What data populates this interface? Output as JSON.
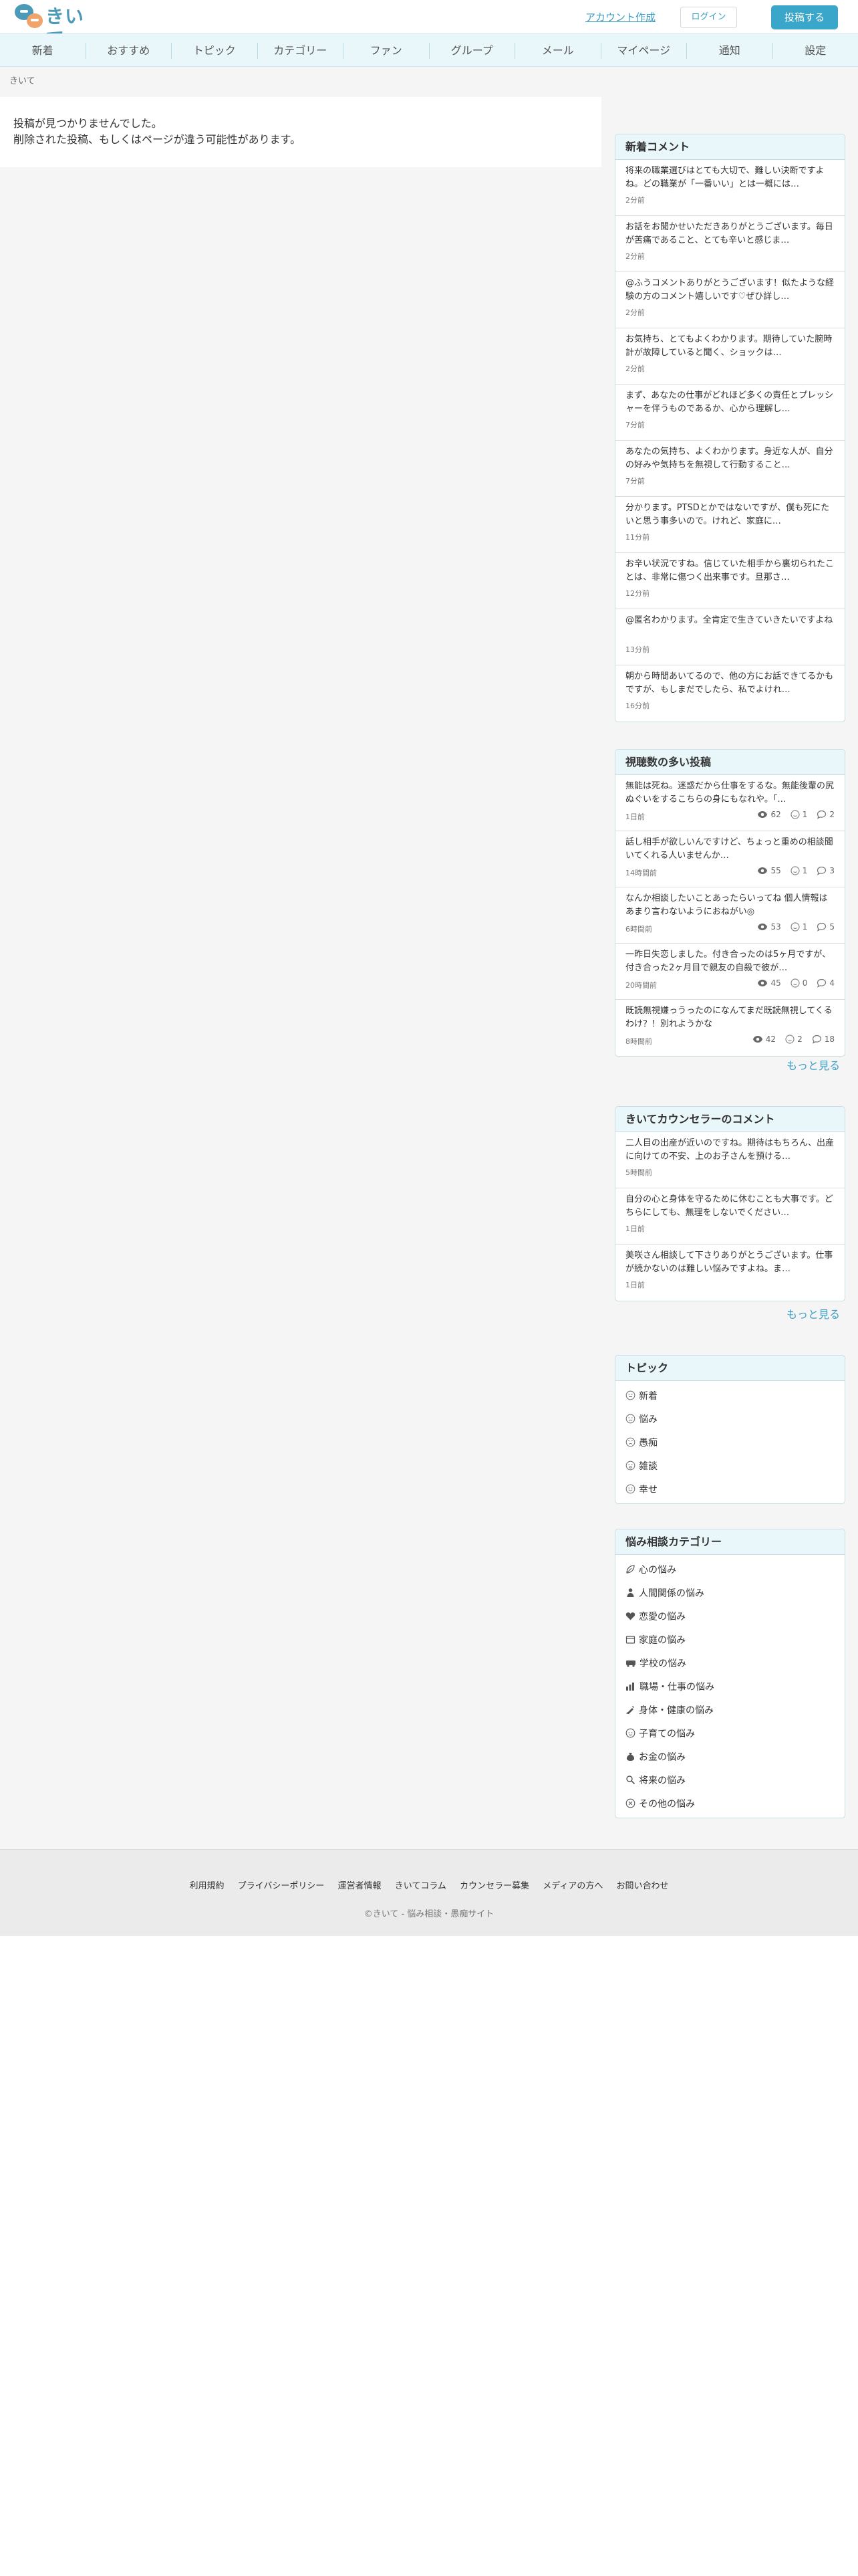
{
  "header": {
    "logo_text": "きいて",
    "signup": "アカウント作成",
    "login": "ログイン",
    "post": "投稿する"
  },
  "nav": [
    "新着",
    "おすすめ",
    "トピック",
    "カテゴリー",
    "ファン",
    "グループ",
    "メール",
    "マイページ",
    "通知",
    "設定"
  ],
  "breadcrumb": "きいて",
  "main": {
    "line1": "投稿が見つかりませんでした。",
    "line2": "削除された投稿、もしくはページが違う可能性があります。"
  },
  "new_comments": {
    "title": "新着コメント",
    "items": [
      {
        "text": "将来の職業選びはとても大切で、難しい決断ですよね。どの職業が「一番いい」とは一概には…",
        "time": "2分前"
      },
      {
        "text": "お話をお聞かせいただきありがとうございます。毎日が苦痛であること、とても辛いと感じま…",
        "time": "2分前"
      },
      {
        "text": "@ふうコメントありがとうございます！似たような経験の方のコメント嬉しいです♡ぜひ詳し…",
        "time": "2分前"
      },
      {
        "text": "お気持ち、とてもよくわかります。期待していた腕時計が故障していると聞く、ショックは…",
        "time": "2分前"
      },
      {
        "text": "まず、あなたの仕事がどれほど多くの責任とプレッシャーを伴うものであるか、心から理解し…",
        "time": "7分前"
      },
      {
        "text": "あなたの気持ち、よくわかります。身近な人が、自分の好みや気持ちを無視して行動すること…",
        "time": "7分前"
      },
      {
        "text": "分かります。PTSDとかではないですが、僕も死にたいと思う事多いので。けれど、家庭に…",
        "time": "11分前"
      },
      {
        "text": "お辛い状況ですね。信じていた相手から裏切られたことは、非常に傷つく出来事です。旦那さ…",
        "time": "12分前"
      },
      {
        "text": "@匿名わかります。全肯定で生きていきたいですよね",
        "time": "13分前"
      },
      {
        "text": "朝から時間あいてるので、他の方にお話できてるかもですが、もしまだでしたら、私でよけれ…",
        "time": "16分前"
      }
    ]
  },
  "popular": {
    "title": "視聴数の多い投稿",
    "items": [
      {
        "text": "無能は死ね。迷惑だから仕事をするな。無能後輩の尻ぬぐいをするこちらの身にもなれや。「…",
        "time": "1日前",
        "views": "62",
        "likes": "1",
        "comments": "2"
      },
      {
        "text": "話し相手が欲しいんですけど、ちょっと重めの相談聞いてくれる人いませんか…",
        "time": "14時間前",
        "views": "55",
        "likes": "1",
        "comments": "3"
      },
      {
        "text": "なんか相談したいことあったらいってね 個人情報はあまり言わないようにおねがい◎",
        "time": "6時間前",
        "views": "53",
        "likes": "1",
        "comments": "5"
      },
      {
        "text": "一昨日失恋しました。付き合ったのは5ヶ月ですが、付き合った2ヶ月目で親友の自殺で彼が…",
        "time": "20時間前",
        "views": "45",
        "likes": "0",
        "comments": "4"
      },
      {
        "text": "既読無視嫌っうったのになんてまだ既読無視してくるわけ？！別れようかな",
        "time": "8時間前",
        "views": "42",
        "likes": "2",
        "comments": "18"
      }
    ],
    "more": "もっと見る"
  },
  "counselor": {
    "title": "きいてカウンセラーのコメント",
    "items": [
      {
        "text": "二人目の出産が近いのですね。期待はもちろん、出産に向けての不安、上のお子さんを預ける…",
        "time": "5時間前"
      },
      {
        "text": "自分の心と身体を守るために休むことも大事です。どちらにしても、無理をしないでください…",
        "time": "1日前"
      },
      {
        "text": "美咲さん相談して下さりありがとうございます。仕事が続かないのは難しい悩みですよね。ま…",
        "time": "1日前"
      }
    ],
    "more": "もっと見る"
  },
  "topics": {
    "title": "トピック",
    "items": [
      "新着",
      "悩み",
      "愚痴",
      "雑談",
      "幸せ"
    ]
  },
  "categories": {
    "title": "悩み相談カテゴリー",
    "items": [
      "心の悩み",
      "人間関係の悩み",
      "恋愛の悩み",
      "家庭の悩み",
      "学校の悩み",
      "職場・仕事の悩み",
      "身体・健康の悩み",
      "子育ての悩み",
      "お金の悩み",
      "将来の悩み",
      "その他の悩み"
    ]
  },
  "footer": {
    "links": [
      "利用規約",
      "プライバシーポリシー",
      "運営者情報",
      "きいてコラム",
      "カウンセラー募集",
      "メディアの方へ",
      "お問い合わせ"
    ],
    "copyright": "©きいて - 悩み相談・愚痴サイト"
  }
}
